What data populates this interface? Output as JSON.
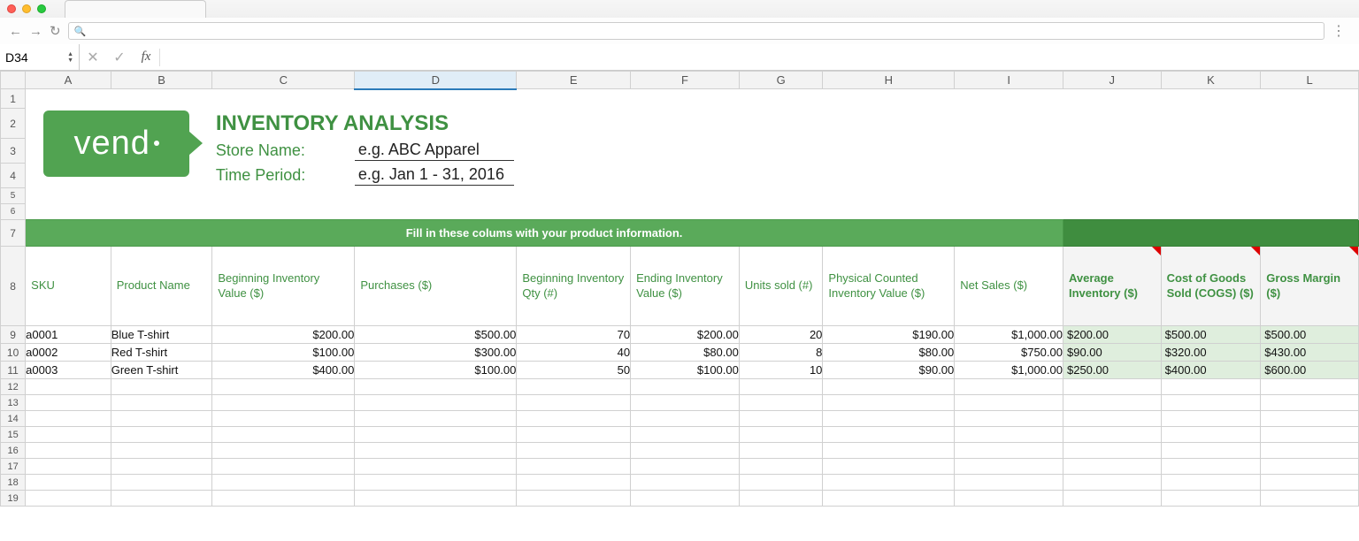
{
  "browser": {
    "url_placeholder": ""
  },
  "formula": {
    "cell_ref": "D34",
    "cancel": "✕",
    "accept": "✓",
    "fx": "fx",
    "value": ""
  },
  "columns": [
    "A",
    "B",
    "C",
    "D",
    "E",
    "F",
    "G",
    "H",
    "I",
    "J",
    "K",
    "L"
  ],
  "logo_text": "vend",
  "title": "INVENTORY ANALYSIS",
  "fields": {
    "store_label": "Store Name:",
    "store_value": "e.g. ABC Apparel",
    "period_label": "Time Period:",
    "period_value": "e.g. Jan 1 - 31, 2016"
  },
  "banner_left": "Fill in these colums with your product information.",
  "headers": {
    "sku": "SKU",
    "name": "Product Name",
    "begin_val": "Beginning Inventory Value ($)",
    "purchases": "Purchases ($)",
    "begin_qty": "Beginning Inventory Qty (#)",
    "end_val": "Ending Inventory Value ($)",
    "units_sold": "Units sold (#)",
    "phys": "Physical Counted Inventory Value ($)",
    "net_sales": "Net Sales ($)",
    "avg_inv": "Average Inventory ($)",
    "cogs": "Cost of Goods Sold (COGS) ($)",
    "gross": "Gross Margin ($)"
  },
  "rows": [
    {
      "sku": "a0001",
      "name": "Blue T-shirt",
      "begin_val": "$200.00",
      "purchases": "$500.00",
      "begin_qty": "70",
      "end_val": "$200.00",
      "units_sold": "20",
      "phys": "$190.00",
      "net_sales": "$1,000.00",
      "avg_inv": "$200.00",
      "cogs": "$500.00",
      "gross": "$500.00"
    },
    {
      "sku": "a0002",
      "name": "Red T-shirt",
      "begin_val": "$100.00",
      "purchases": "$300.00",
      "begin_qty": "40",
      "end_val": "$80.00",
      "units_sold": "8",
      "phys": "$80.00",
      "net_sales": "$750.00",
      "avg_inv": "$90.00",
      "cogs": "$320.00",
      "gross": "$430.00"
    },
    {
      "sku": "a0003",
      "name": "Green T-shirt",
      "begin_val": "$400.00",
      "purchases": "$100.00",
      "begin_qty": "50",
      "end_val": "$100.00",
      "units_sold": "10",
      "phys": "$90.00",
      "net_sales": "$1,000.00",
      "avg_inv": "$250.00",
      "cogs": "$400.00",
      "gross": "$600.00"
    }
  ],
  "row_labels": [
    "1",
    "2",
    "3",
    "4",
    "5",
    "6",
    "7",
    "8",
    "9",
    "10",
    "11",
    "12",
    "13",
    "14",
    "15",
    "16",
    "17",
    "18",
    "19"
  ]
}
